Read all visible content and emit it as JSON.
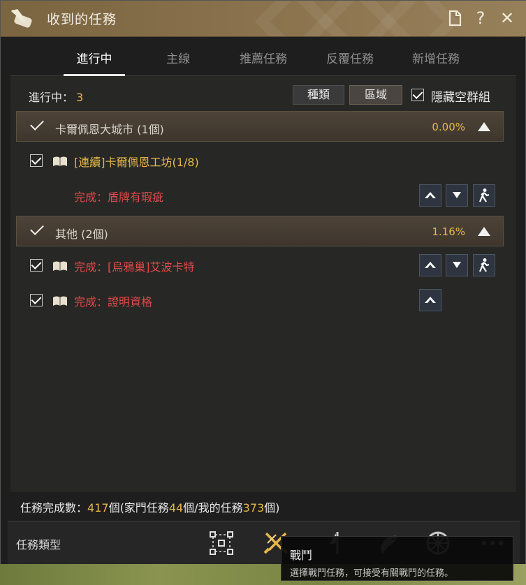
{
  "window": {
    "title": "收到的任務",
    "icons": {
      "title": "scroll-quill-icon",
      "doc": "document-icon",
      "help": "?",
      "close": "✕"
    }
  },
  "tabs": [
    {
      "label": "進行中",
      "active": true
    },
    {
      "label": "主線",
      "active": false
    },
    {
      "label": "推薦任務",
      "active": false
    },
    {
      "label": "反覆任務",
      "active": false
    },
    {
      "label": "新增任務",
      "active": false
    }
  ],
  "progress": {
    "label": "進行中：",
    "count": "3"
  },
  "filters": {
    "type_label": "種類",
    "region_label": "區域",
    "selected": "區域"
  },
  "hide_empty": {
    "label": "隱藏空群組",
    "checked": true
  },
  "groups": [
    {
      "name": "卡爾佩恩大城市 (1個)",
      "percent": "0.00%",
      "quests": [
        {
          "title": "[連續]卡爾佩恩工坊(1/8)",
          "color": "#e6b84a",
          "checked": true,
          "book": true
        },
        {
          "title": "完成：盾牌有瑕疵",
          "color": "#e04a4a",
          "checked": false,
          "book": false,
          "actions": [
            "up",
            "down",
            "navigate"
          ]
        }
      ]
    },
    {
      "name": "其他 (2個)",
      "percent": "1.16%",
      "quests": [
        {
          "title": "完成：[烏鴉巢]艾波卡特",
          "color": "#e04a4a",
          "checked": true,
          "book": true,
          "actions": [
            "up",
            "down",
            "navigate"
          ]
        },
        {
          "title": "完成：證明資格",
          "color": "#e04a4a",
          "checked": true,
          "book": true,
          "actions": [
            "up"
          ]
        }
      ]
    }
  ],
  "footer": {
    "prefix": "任務完成數：",
    "total": "417",
    "mid1": "個(家門任務",
    "family": "44",
    "mid2": "個/我的任務",
    "mine": "373",
    "suffix": "個)"
  },
  "type_bar": {
    "label": "任務類型",
    "icons": [
      "grid-icon",
      "swords-icon",
      "sail-icon",
      "fish-icon",
      "wheel-icon",
      "more-icon"
    ]
  },
  "tooltip": {
    "title": "戰鬥",
    "description": "選擇戰鬥任務，可接受有關戰鬥的任務。"
  },
  "colors": {
    "gold": "#e6b84a",
    "red": "#e04a4a",
    "title_bar": "#8d7550"
  }
}
